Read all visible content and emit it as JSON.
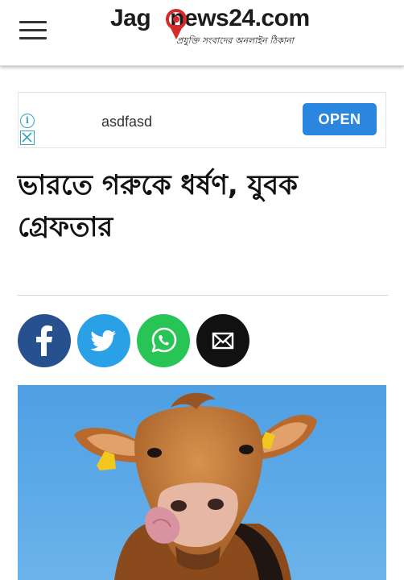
{
  "header": {
    "logo_main_a": "Jag",
    "logo_main_b": "news24.com",
    "logo_tagline": "প্রযুক্তি সংবাদের অনলাইন ঠিকানা"
  },
  "ad": {
    "text": "asdfasd",
    "open_label": "OPEN",
    "info_glyph": "i"
  },
  "article": {
    "headline": "ভারতে গরুকে ধর্ষণ, যুবক গ্রেফতার"
  },
  "share": {
    "icons": [
      "facebook-icon",
      "twitter-icon",
      "whatsapp-icon",
      "mail-icon"
    ]
  },
  "colors": {
    "brand_red": "#d62a2a",
    "open_button": "#2b86e0",
    "facebook": "#27508f",
    "twitter": "#2aa0e6",
    "whatsapp": "#28c456",
    "mail": "#111111",
    "sky": "#5aa7e6"
  }
}
